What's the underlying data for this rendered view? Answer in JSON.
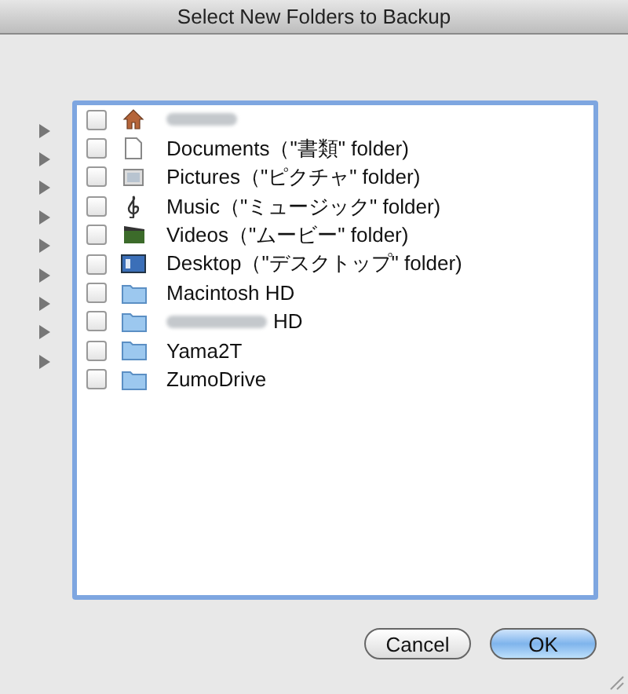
{
  "window": {
    "title": "Select New Folders to Backup"
  },
  "items": [
    {
      "redacted": true,
      "kind": "home",
      "expandable": true,
      "checked": false
    },
    {
      "label": "Documents（\"書類\" folder)",
      "kind": "document",
      "expandable": true,
      "checked": false
    },
    {
      "label": "Pictures（\"ピクチャ\" folder)",
      "kind": "picture",
      "expandable": true,
      "checked": false
    },
    {
      "label": "Music（\"ミュージック\" folder)",
      "kind": "music",
      "expandable": true,
      "checked": false
    },
    {
      "label": "Videos（\"ムービー\" folder)",
      "kind": "video",
      "expandable": true,
      "checked": false
    },
    {
      "label": "Desktop（\"デスクトップ\" folder)",
      "kind": "desktop",
      "expandable": true,
      "checked": false
    },
    {
      "label": "Macintosh HD",
      "kind": "folder",
      "expandable": true,
      "checked": false
    },
    {
      "redacted": true,
      "label": "HD",
      "kind": "folder",
      "expandable": true,
      "checked": false
    },
    {
      "label": "Yama2T",
      "kind": "folder",
      "expandable": true,
      "checked": false
    },
    {
      "label": "ZumoDrive",
      "kind": "folder",
      "expandable": false,
      "checked": false
    }
  ],
  "buttons": [
    {
      "label": "Cancel",
      "default": false
    },
    {
      "label": "OK",
      "default": true
    }
  ]
}
